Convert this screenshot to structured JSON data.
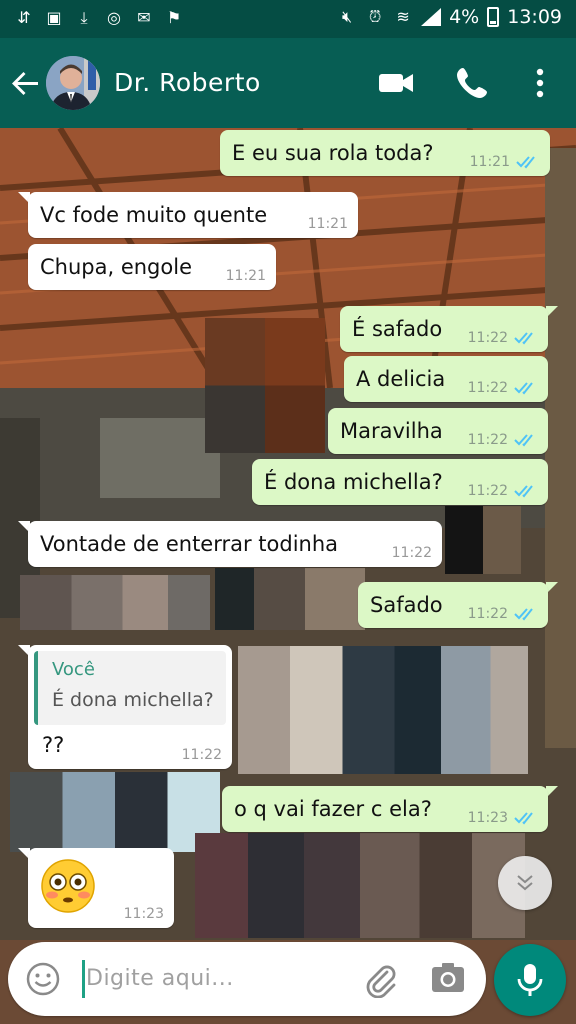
{
  "status_bar": {
    "battery_percent": "4%",
    "time": "13:09",
    "icons": [
      "sync-icon",
      "image-icon",
      "download-icon",
      "voicemail-icon",
      "mail-icon",
      "flag-icon",
      "mute-icon",
      "alarm-icon",
      "wifi-icon",
      "signal-icon",
      "battery-icon"
    ]
  },
  "header": {
    "contact_name": "Dr. Roberto",
    "icons": [
      "back-arrow-icon",
      "video-call-icon",
      "phone-icon",
      "more-vert-icon"
    ]
  },
  "messages": [
    {
      "direction": "out",
      "text": "E eu sua rola toda?",
      "time": "11:21",
      "status": "read"
    },
    {
      "direction": "in",
      "text": "Vc fode muito quente",
      "time": "11:21"
    },
    {
      "direction": "in",
      "text": "Chupa, engole",
      "time": "11:21"
    },
    {
      "direction": "out",
      "text": "É safado",
      "time": "11:22",
      "status": "read"
    },
    {
      "direction": "out",
      "text": "A delicia",
      "time": "11:22",
      "status": "read"
    },
    {
      "direction": "out",
      "text": "Maravilha",
      "time": "11:22",
      "status": "read"
    },
    {
      "direction": "out",
      "text": "É dona michella?",
      "time": "11:22",
      "status": "read"
    },
    {
      "direction": "in",
      "text": "Vontade de enterrar todinha",
      "time": "11:22"
    },
    {
      "direction": "out",
      "text": "Safado",
      "time": "11:22",
      "status": "read"
    },
    {
      "direction": "in",
      "quote_author": "Você",
      "quote_text": "É dona michella?",
      "text": "??",
      "time": "11:22"
    },
    {
      "direction": "out",
      "text": "o q vai fazer c ela?",
      "time": "11:23",
      "status": "read"
    },
    {
      "direction": "in",
      "emoji": "flushed-face",
      "time": "11:23"
    }
  ],
  "input": {
    "placeholder": "Digite aqui..."
  },
  "colors": {
    "header": "#075e54",
    "status_bar": "#054d44",
    "outgoing_bubble": "#dcf8c6",
    "incoming_bubble": "#ffffff",
    "accent": "#00897b",
    "read_ticks": "#4fc3f7"
  }
}
